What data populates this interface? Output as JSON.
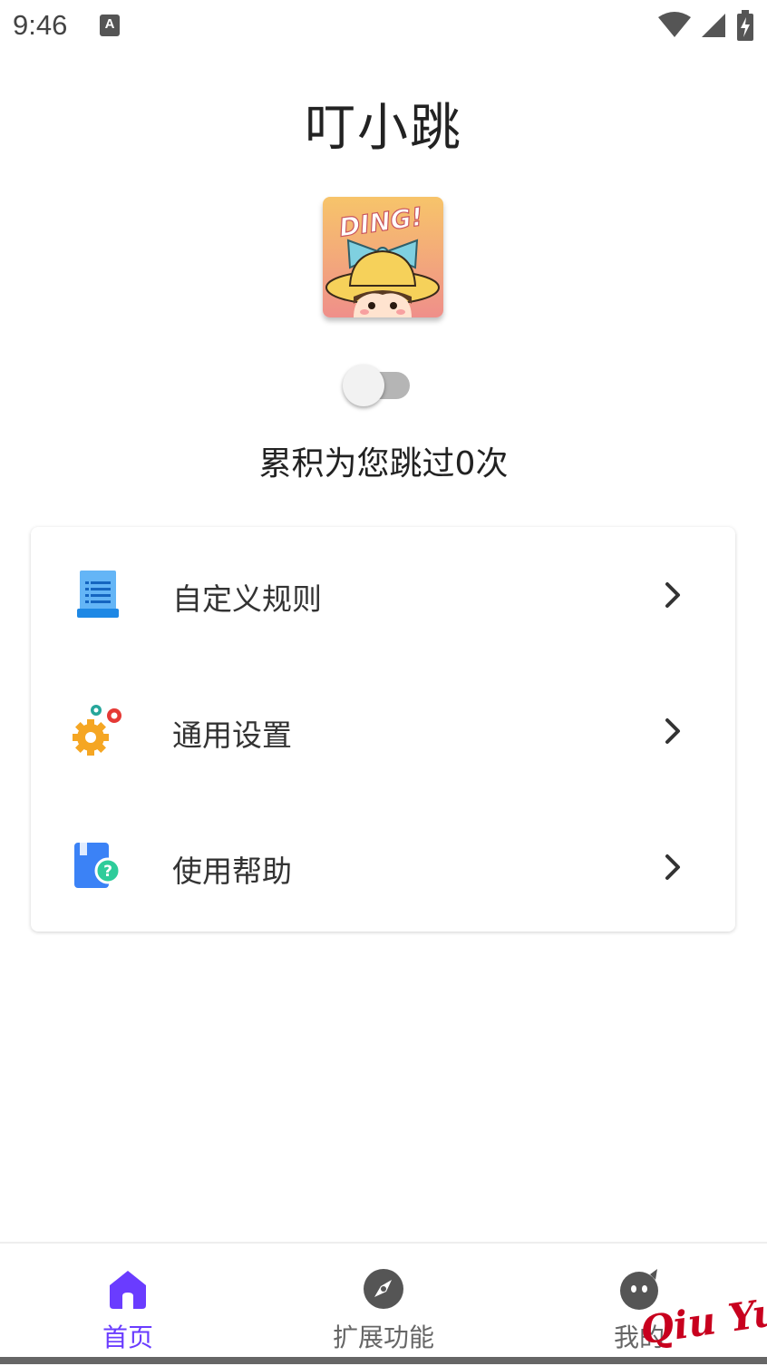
{
  "status_bar": {
    "time": "9:46",
    "badge": "A"
  },
  "app": {
    "title": "叮小跳",
    "logo_text": "DING!"
  },
  "switch": {
    "enabled": false
  },
  "stats": {
    "skip_text": "累积为您跳过0次"
  },
  "menu": [
    {
      "label": "自定义规则",
      "icon": "document-list-icon"
    },
    {
      "label": "通用设置",
      "icon": "gears-icon"
    },
    {
      "label": "使用帮助",
      "icon": "help-book-icon"
    }
  ],
  "bottom_nav": [
    {
      "label": "首页",
      "icon": "home-icon",
      "active": true
    },
    {
      "label": "扩展功能",
      "icon": "compass-icon",
      "active": false
    },
    {
      "label": "我的",
      "icon": "profile-face-icon",
      "active": false
    }
  ],
  "watermark": "Qiu Yue",
  "colors": {
    "accent": "#6a3cff",
    "nav_inactive": "#666666"
  }
}
